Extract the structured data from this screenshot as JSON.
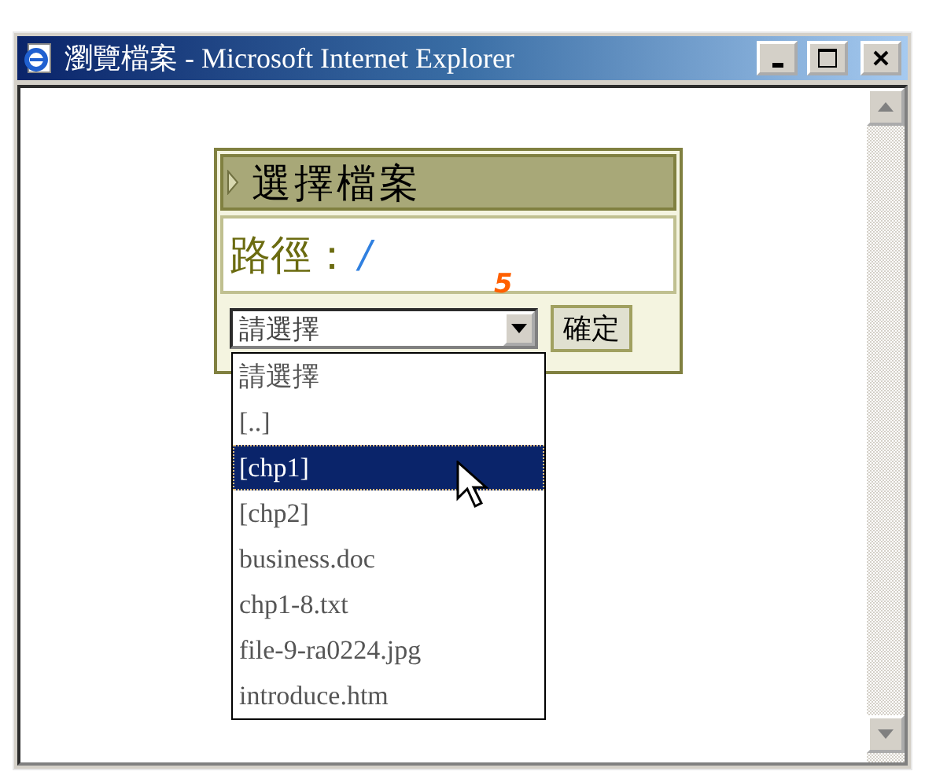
{
  "window": {
    "title": "瀏覽檔案 - Microsoft Internet Explorer"
  },
  "panel": {
    "title": "選擇檔案",
    "path_label": "路徑：",
    "path_value": "/",
    "marker": "5",
    "ok_button": "確定",
    "select": {
      "value": "請選擇",
      "options": [
        {
          "label": "請選擇",
          "highlighted": false
        },
        {
          "label": "[..]",
          "highlighted": false
        },
        {
          "label": "[chp1]",
          "highlighted": true
        },
        {
          "label": "[chp2]",
          "highlighted": false
        },
        {
          "label": "business.doc",
          "highlighted": false
        },
        {
          "label": "chp1-8.txt",
          "highlighted": false
        },
        {
          "label": "file-9-ra0224.jpg",
          "highlighted": false
        },
        {
          "label": "introduce.htm",
          "highlighted": false
        }
      ]
    }
  }
}
